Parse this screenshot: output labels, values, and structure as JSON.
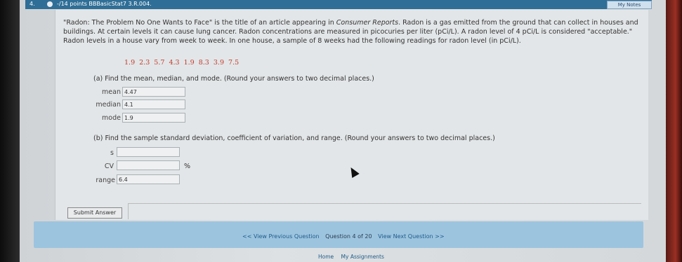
{
  "header": {
    "question_number": "4.",
    "points": "-/14 points BBBasicStat7 3.R.004.",
    "my_notes": "My Notes"
  },
  "problem": {
    "text_before_source": "\"Radon: The Problem No One Wants to Face\" is the title of an article appearing in ",
    "source": "Consumer Reports",
    "text_after_source": ". Radon is a gas emitted from the ground that can collect in houses and buildings. At certain levels it can cause lung cancer. Radon concentrations are measured in picocuries per liter (pCi/L). A radon level of 4 pCi/L is considered \"acceptable.\" Radon levels in a house vary from week to week. In one house, a sample of 8 weeks had the following readings for radon level (in pCi/L).",
    "data_values": "1.9  2.3  5.7  4.3  1.9  8.3  3.9  7.5"
  },
  "part_a": {
    "prompt": "(a) Find the mean, median, and mode. (Round your answers to two decimal places.)",
    "mean_label": "mean",
    "mean_value": "4.47",
    "median_label": "median",
    "median_value": "4.1",
    "mode_label": "mode",
    "mode_value": "1.9"
  },
  "part_b": {
    "prompt": "(b) Find the sample standard deviation, coefficient of variation, and range. (Round your answers to two decimal places.)",
    "s_label": "s",
    "s_value": "",
    "cv_label": "CV",
    "cv_value": "",
    "cv_unit": "%",
    "range_label": "range",
    "range_value": "6.4"
  },
  "actions": {
    "submit_label": "Submit Answer"
  },
  "navigation": {
    "previous": "<< View Previous Question",
    "status": "Question 4 of 20",
    "next": "View Next Question >>"
  },
  "footer": {
    "home": "Home",
    "assignments": "My Assignments"
  },
  "colors": {
    "header_bar": "#2f6e96",
    "data_values": "#c0392b",
    "nav_bar": "#9cc4df",
    "link": "#1f5c8a"
  }
}
